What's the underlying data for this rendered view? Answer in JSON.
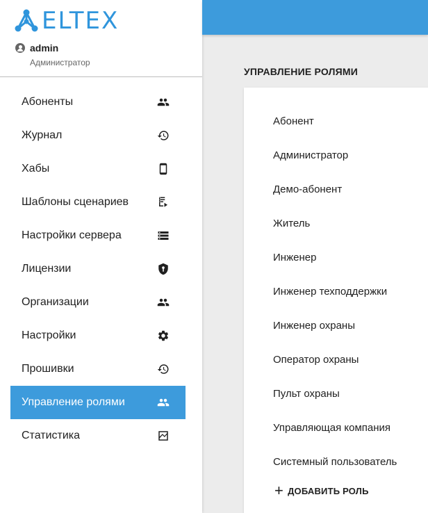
{
  "brand": {
    "logo_text": "ELTEX"
  },
  "user": {
    "name": "admin",
    "role": "Администратор"
  },
  "sidebar": {
    "items": [
      {
        "label": "Абоненты",
        "icon": "people-icon",
        "active": false
      },
      {
        "label": "Журнал",
        "icon": "history-icon",
        "active": false
      },
      {
        "label": "Хабы",
        "icon": "phone-icon",
        "active": false
      },
      {
        "label": "Шаблоны сценариев",
        "icon": "playlist-play-icon",
        "active": false
      },
      {
        "label": "Настройки сервера",
        "icon": "storage-icon",
        "active": false
      },
      {
        "label": "Лицензии",
        "icon": "license-shield-icon",
        "active": false
      },
      {
        "label": "Организации",
        "icon": "people-icon",
        "active": false
      },
      {
        "label": "Настройки",
        "icon": "gear-icon",
        "active": false
      },
      {
        "label": "Прошивки",
        "icon": "history-icon",
        "active": false
      },
      {
        "label": "Управление ролями",
        "icon": "people-icon",
        "active": true
      },
      {
        "label": "Статистика",
        "icon": "chart-icon",
        "active": false
      }
    ]
  },
  "main": {
    "title": "УПРАВЛЕНИЕ РОЛЯМИ",
    "roles": [
      "Абонент",
      "Администратор",
      "Демо-абонент",
      "Житель",
      "Инженер",
      "Инженер техподдержки",
      "Инженер охраны",
      "Оператор охраны",
      "Пульт охраны",
      "Управляющая компания",
      "Системный пользователь"
    ],
    "add_role_label": "ДОБАВИТЬ РОЛЬ",
    "add_role_icon": "plus-icon"
  },
  "colors": {
    "accent": "#3d9bdc",
    "logo": "#2f95dc"
  }
}
